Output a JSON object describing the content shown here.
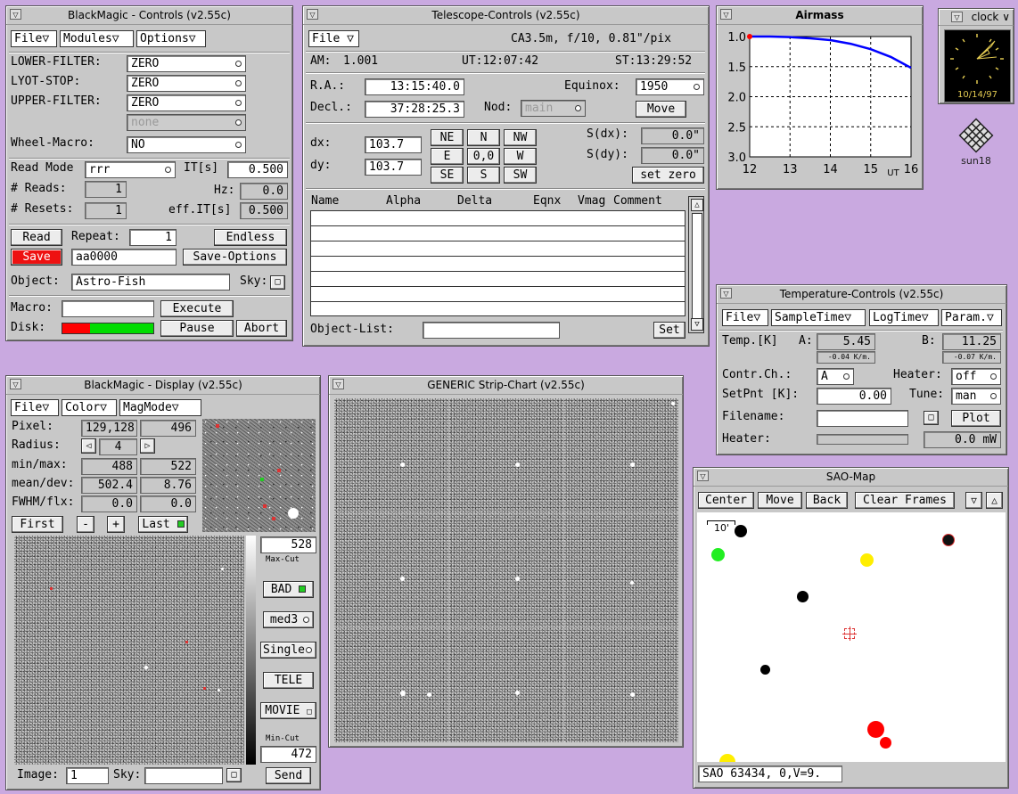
{
  "controls": {
    "title": "BlackMagic - Controls (v2.55c)",
    "menu": [
      "File",
      "Modules",
      "Options"
    ],
    "lower_filter_label": "LOWER-FILTER:",
    "lower_filter": "ZERO",
    "lyot_stop_label": "LYOT-STOP:",
    "lyot_stop": "ZERO",
    "upper_filter_label": "UPPER-FILTER:",
    "upper_filter": "ZERO",
    "extra_filter": "none",
    "wheel_macro_label": "Wheel-Macro:",
    "wheel_macro": "NO",
    "read_mode_label": "Read Mode",
    "read_mode": "rrr",
    "it_label": "IT[s]",
    "it": "0.500",
    "reads_label": "# Reads:",
    "reads": "1",
    "hz_label": "Hz:",
    "hz": "0.0",
    "resets_label": "# Resets:",
    "resets": "1",
    "eff_it_label": "eff.IT[s]",
    "eff_it": "0.500",
    "read_btn": "Read",
    "repeat_label": "Repeat:",
    "repeat": "1",
    "endless_btn": "Endless",
    "save_btn": "Save",
    "filename": "aa0000",
    "save_options_btn": "Save-Options",
    "object_label": "Object:",
    "object": "Astro-Fish",
    "sky_label": "Sky:",
    "macro_label": "Macro:",
    "macro": "",
    "execute_btn": "Execute",
    "disk_label": "Disk:",
    "pause_btn": "Pause",
    "abort_btn": "Abort",
    "disk_used": 0.3,
    "disk_used_color": "#ff0000",
    "disk_free_color": "#00dd00"
  },
  "telescope": {
    "title": "Telescope-Controls (v2.55c)",
    "file_menu": "File",
    "info": "CA3.5m, f/10, 0.81\"/pix",
    "am_label": "AM:",
    "am": "1.001",
    "ut": "UT:12:07:42",
    "st": "ST:13:29:52",
    "ra_label": "R.A.:",
    "ra": "13:15:40.0",
    "equinox_label": "Equinox:",
    "equinox": "1950",
    "decl_label": "Decl.:",
    "decl": "37:28:25.3",
    "nod_label": "Nod:",
    "nod": "main",
    "move_btn": "Move",
    "dx_label": "dx:",
    "dx": "103.7",
    "dy_label": "dy:",
    "dy": "103.7",
    "pad": [
      "NE",
      "N",
      "NW",
      "E",
      "0,0",
      "W",
      "SE",
      "S",
      "SW"
    ],
    "sdx_label": "S(dx):",
    "sdx": "0.0\"",
    "sdy_label": "S(dy):",
    "sdy": "0.0\"",
    "set_zero_btn": "set zero",
    "columns": [
      "Name",
      "Alpha",
      "Delta",
      "Eqnx",
      "Vmag",
      "Comment"
    ],
    "object_list_label": "Object-List:",
    "set_btn": "Set"
  },
  "airmass": {
    "title": "Airmass",
    "chart_data": {
      "type": "line",
      "x": [
        12,
        12.5,
        13,
        13.5,
        14,
        14.5,
        15,
        15.5,
        16
      ],
      "y": [
        1.0,
        1.0,
        1.01,
        1.03,
        1.06,
        1.12,
        1.21,
        1.34,
        1.52
      ],
      "current": {
        "x": 12.0,
        "y": 1.0
      },
      "xlim": [
        12,
        16
      ],
      "ylim": [
        1.0,
        3.0
      ],
      "xticks": [
        "12",
        "13",
        "14",
        "15",
        "16"
      ],
      "yticks": [
        "1.0",
        "1.5",
        "2.0",
        "2.5",
        "3.0"
      ],
      "xlabel": "UT",
      "line_color": "#0000ff",
      "marker_color": "#ff0000",
      "grid": true
    }
  },
  "clock": {
    "title": "clock",
    "date": "10/14/97",
    "host": "sun18"
  },
  "temperature": {
    "title": "Temperature-Controls (v2.55c)",
    "menu": [
      "File",
      "SampleTime",
      "LogTime",
      "Param."
    ],
    "temp_label": "Temp.[K]",
    "a_label": "A:",
    "a": "5.45",
    "a_rate": "-0.04 K/m.",
    "b_label": "B:",
    "b": "11.25",
    "b_rate": "-0.07 K/m.",
    "contr_label": "Contr.Ch.:",
    "contr": "A",
    "heater_sel_label": "Heater:",
    "heater_sel": "off",
    "setpnt_label": "SetPnt [K]:",
    "setpnt": "0.00",
    "tune_label": "Tune:",
    "tune": "man",
    "filename_label": "Filename:",
    "plot_btn": "Plot",
    "heater_label": "Heater:",
    "heater_power": "0.0 mW"
  },
  "display": {
    "title": "BlackMagic - Display (v2.55c)",
    "menu": [
      "File",
      "Color",
      "MagMode"
    ],
    "pixel_label": "Pixel:",
    "pixel_xy": "129,128",
    "pixel_val": "496",
    "radius_label": "Radius:",
    "radius": "4",
    "minmax_label": "min/max:",
    "min": "488",
    "max": "522",
    "meandev_label": "mean/dev:",
    "mean": "502.4",
    "dev": "8.76",
    "fwhm_label": "FWHM/flx:",
    "fwhm": "0.0",
    "flx": "0.0",
    "first_btn": "First",
    "minus_btn": "-",
    "plus_btn": "+",
    "last_btn": "Last",
    "max_cut": "528",
    "max_cut_label": "Max-Cut",
    "bad_btn": "BAD",
    "med_btn": "med3",
    "single_btn": "Single",
    "tele_btn": "TELE",
    "movie_btn": "MOVIE",
    "min_cut_label": "Min-Cut",
    "min_cut": "472",
    "image_label": "Image:",
    "image": "1",
    "sky_label": "Sky:",
    "send_btn": "Send"
  },
  "strip": {
    "title": "GENERIC Strip-Chart (v2.55c)"
  },
  "sao": {
    "title": "SAO-Map",
    "buttons": [
      "Center",
      "Move",
      "Back",
      "Clear Frames"
    ],
    "scale": "10'",
    "status": "SAO  63434, 0,V=9."
  }
}
